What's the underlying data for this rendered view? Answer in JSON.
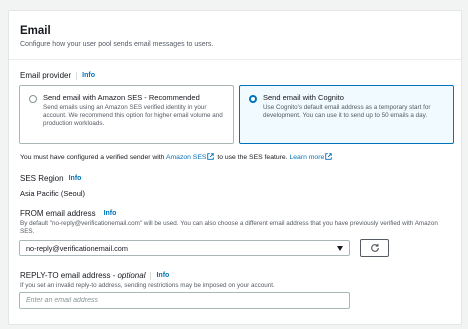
{
  "header": {
    "title": "Email",
    "subtitle": "Configure how your user pool sends email messages to users."
  },
  "email_provider": {
    "label": "Email provider",
    "info": "Info",
    "options": [
      {
        "title": "Send email with Amazon SES - Recommended",
        "description": "Send emails using an Amazon SES verified identity in your account. We recommend this option for higher email volume and production workloads.",
        "selected": false
      },
      {
        "title": "Send email with Cognito",
        "description": "Use Cognito's default email address as a temporary start for development. You can use it to send up to 50 emails a day.",
        "selected": true
      }
    ]
  },
  "ses_note": {
    "prefix": "You must have configured a verified sender with",
    "link1": "Amazon SES",
    "middle": "to use the SES feature.",
    "link2": "Learn more"
  },
  "ses_region": {
    "label": "SES Region",
    "info": "Info",
    "value": "Asia Pacific (Seoul)"
  },
  "from_email": {
    "label": "FROM email address",
    "info": "Info",
    "hint": "By default \"no-reply@verificationemail.com\" will be used. You can also choose a different email address that you have previously verified with Amazon SES.",
    "selected": "no-reply@verificationemail.com",
    "refresh_icon": "refresh-icon"
  },
  "reply_to": {
    "label": "REPLY-TO email address",
    "optional": "optional",
    "info": "Info",
    "hint": "If you set an invalid reply-to address, sending restrictions may be imposed on your account.",
    "placeholder": "Enter an email address"
  },
  "colors": {
    "link": "#0073bb",
    "selected_border": "#0073bb",
    "selected_bg": "#f1faff",
    "text": "#16191f",
    "muted": "#545b64"
  }
}
